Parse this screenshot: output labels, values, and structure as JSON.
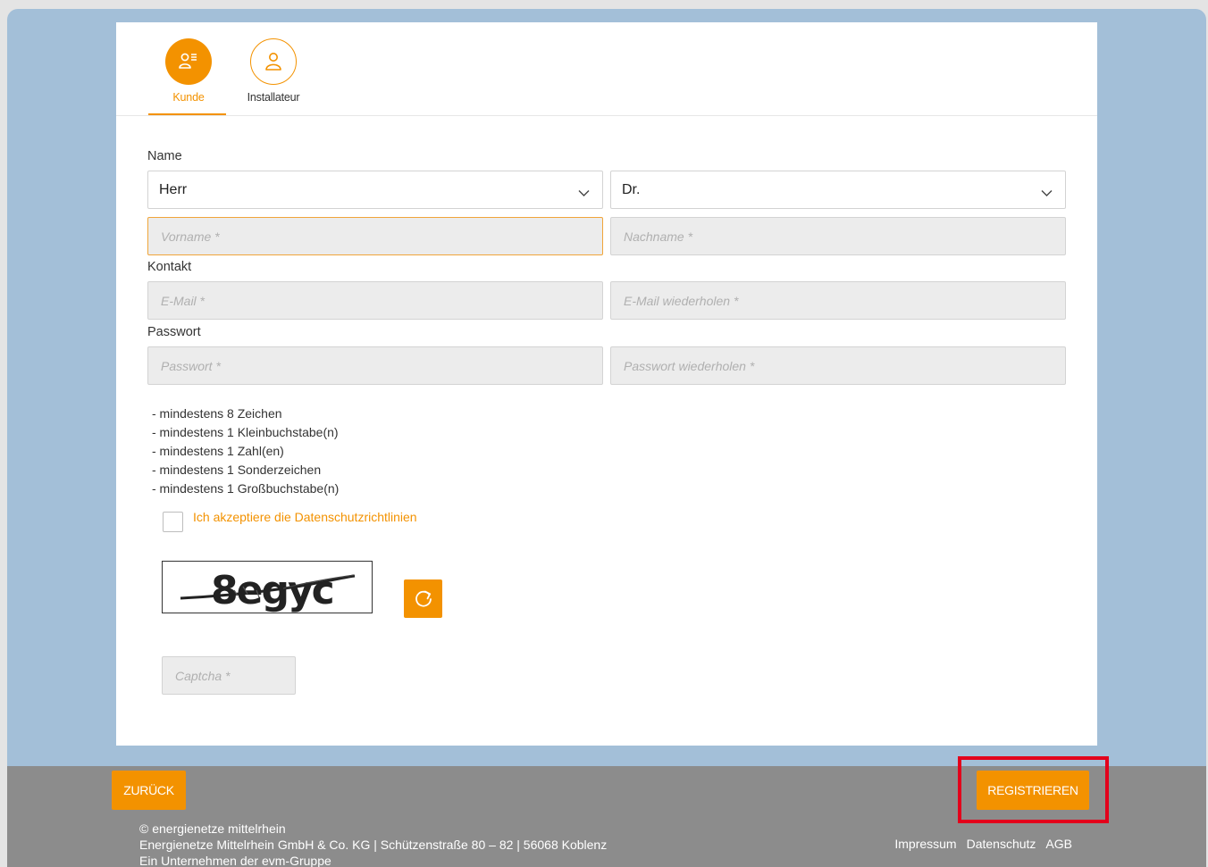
{
  "tabs": [
    {
      "label": "Kunde",
      "icon": "customer-list-icon",
      "active": true
    },
    {
      "label": "Installateur",
      "icon": "user-icon",
      "active": false
    }
  ],
  "form": {
    "name_label": "Name",
    "salutation_value": "Herr",
    "title_value": "Dr.",
    "firstname_placeholder": "Vorname *",
    "lastname_placeholder": "Nachname *",
    "contact_label": "Kontakt",
    "email_placeholder": "E-Mail *",
    "email_repeat_placeholder": "E-Mail wiederholen *",
    "password_label": "Passwort",
    "password_placeholder": "Passwort *",
    "password_repeat_placeholder": "Passwort wiederholen *",
    "rules": [
      "- mindestens 8 Zeichen",
      "- mindestens 1 Kleinbuchstabe(n)",
      "- mindestens 1 Zahl(en)",
      "- mindestens 1 Sonderzeichen",
      "- mindestens 1 Großbuchstabe(n)"
    ],
    "consent_label": "Ich akzeptiere die Datenschutzrichtlinien",
    "captcha_text": "8egyc",
    "captcha_placeholder": "Captcha *"
  },
  "footer": {
    "back_label": "ZURÜCK",
    "register_label": "REGISTRIEREN",
    "copyright": "© energienetze mittelrhein",
    "address": "Energienetze Mittelrhein GmbH & Co. KG | Schützenstraße 80 – 82 | 56068 Koblenz",
    "group": "Ein Unternehmen der evm-Gruppe",
    "links": [
      "Impressum",
      "Datenschutz",
      "AGB"
    ]
  },
  "colors": {
    "accent": "#f39200",
    "background": "#a3bfd8",
    "footer": "#8c8c8c",
    "highlight": "#e3001b"
  }
}
